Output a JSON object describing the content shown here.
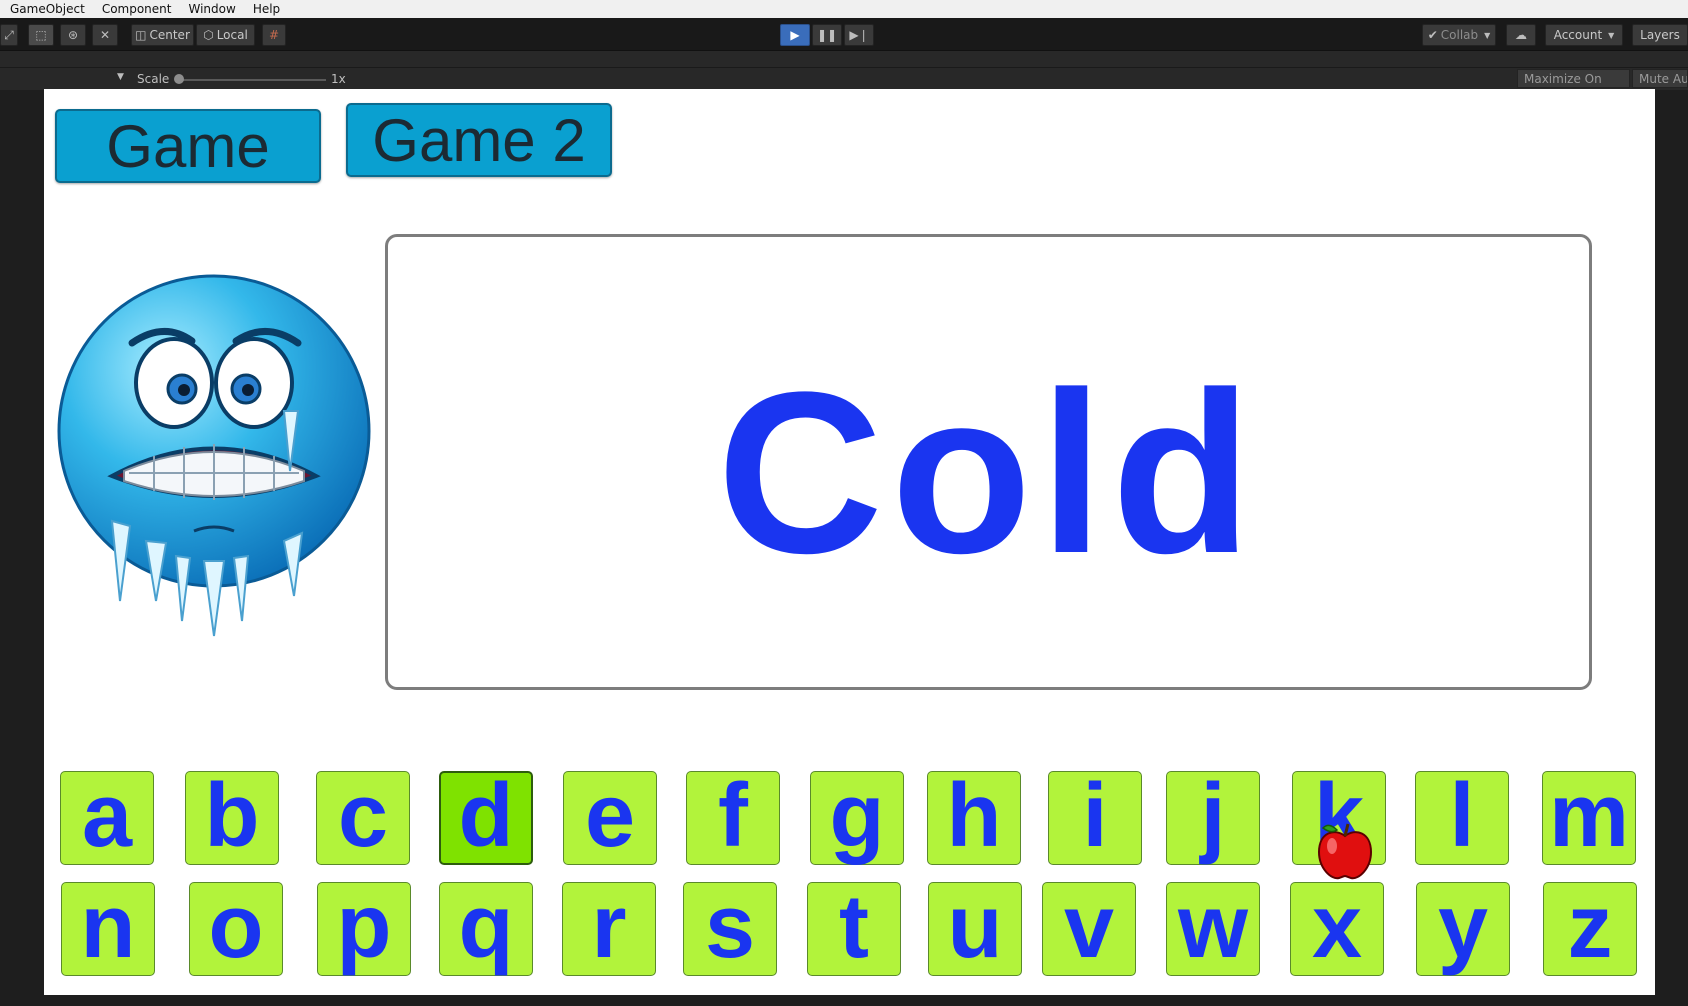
{
  "menu": [
    "GameObject",
    "Component",
    "Window",
    "Help"
  ],
  "toolbar": {
    "pivot_label": "Center",
    "space_label": "Local",
    "collab_label": "Collab",
    "account_label": "Account",
    "layers_label": "Layers",
    "play_state": "playing"
  },
  "game_view": {
    "scale_label": "Scale",
    "scale_value": "1x",
    "maximize_label": "Maximize On Play",
    "mute_label": "Mute Aud"
  },
  "game": {
    "buttons": [
      "Game",
      "Game 2"
    ],
    "word": "Cold",
    "picture": "freezing-face",
    "letters_row1": [
      "a",
      "b",
      "c",
      "d",
      "e",
      "f",
      "g",
      "h",
      "i",
      "j",
      "k",
      "l",
      "m"
    ],
    "letters_row2": [
      "n",
      "o",
      "p",
      "q",
      "r",
      "s",
      "t",
      "u",
      "v",
      "w",
      "x",
      "y",
      "z"
    ],
    "selected_letter": "d",
    "cursor": "apple"
  },
  "colors": {
    "word": "#1a35f0",
    "key_bg": "#b2f33b",
    "key_selected_bg": "#7fe200",
    "game_button_bg": "#0aa0d0",
    "play_button": "#3a6dbb"
  }
}
